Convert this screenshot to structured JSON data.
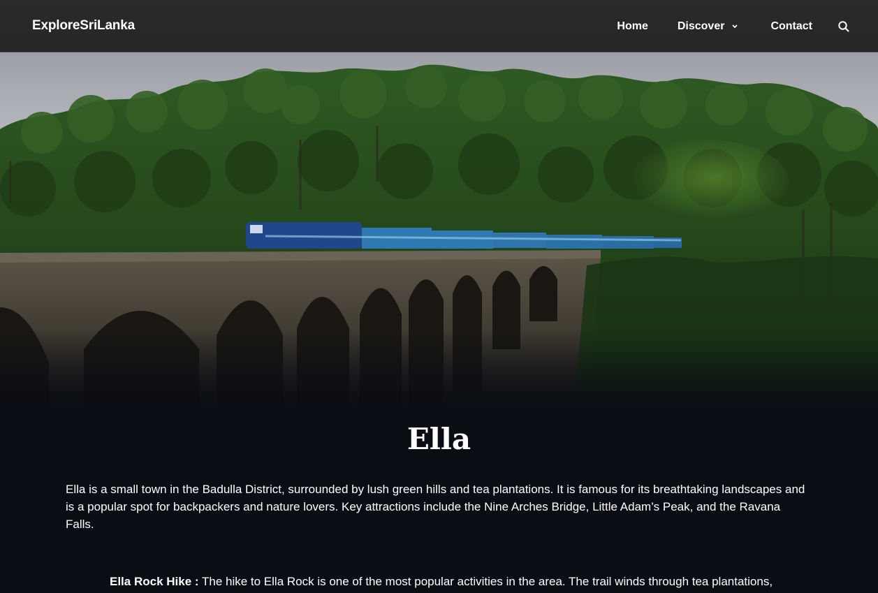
{
  "brand": {
    "name": "ExploreSriLanka"
  },
  "nav": {
    "home": "Home",
    "discover": "Discover",
    "contact": "Contact",
    "dropdown_icon": "chevron-down-icon",
    "search_icon": "search-icon"
  },
  "hero": {
    "image": "train-on-nine-arches-bridge-photo"
  },
  "page": {
    "title": "Ella",
    "intro": "Ella is a small town in the Badulla District, surrounded by lush green hills and tea plantations. It is famous for its breathtaking landscapes and is a popular spot for backpackers and nature lovers. Key attractions include the Nine Arches Bridge, Little Adam’s Peak, and the Ravana Falls.",
    "activity_label": "Ella Rock Hike :",
    "activity_text": " The hike to Ella Rock is one of the most popular activities in the area. The trail winds through tea plantations,"
  },
  "colors": {
    "background": "#0a0d14",
    "navbar": "#282828",
    "text": "#ffffff"
  }
}
